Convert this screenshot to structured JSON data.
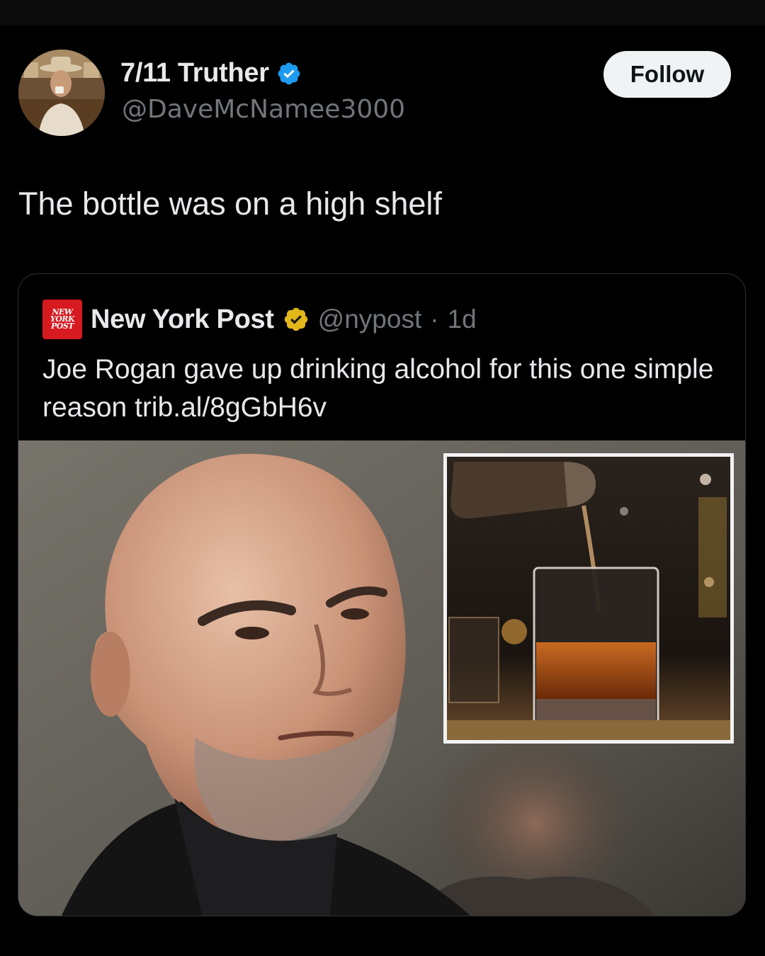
{
  "author": {
    "display_name": "7/11 Truther",
    "handle": "@DaveMcNamee3000",
    "verified": true
  },
  "follow_button": {
    "label": "Follow"
  },
  "tweet": {
    "text": "The bottle was on a high shelf"
  },
  "quoted_tweet": {
    "logo": {
      "line1": "NEW",
      "line2": "YORK",
      "line3": "POST"
    },
    "display_name": "New York Post",
    "verified": true,
    "handle": "@nypost",
    "separator": "·",
    "time": "1d",
    "text": "Joe Rogan gave up drinking alcohol for this one simple reason trib.al/8gGbH6v"
  },
  "colors": {
    "background": "#000000",
    "text_primary": "#e7e9ea",
    "text_secondary": "#71767b",
    "verified_blue": "#1d9bf0",
    "verified_gold": "#e2b719",
    "nypost_red": "#d71920"
  }
}
